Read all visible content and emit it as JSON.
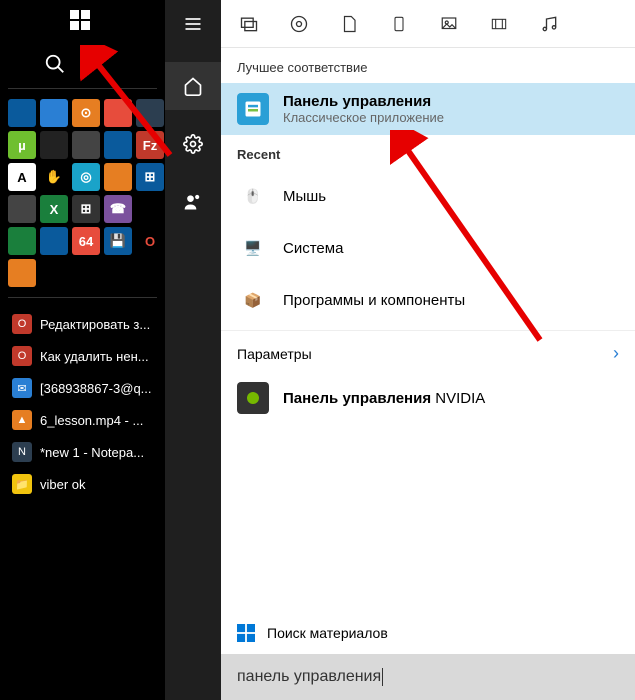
{
  "taskbar_items": [
    {
      "label": "Редактировать з...",
      "icon_bg": "#c0392b",
      "icon_txt": "O"
    },
    {
      "label": "Как удалить нен...",
      "icon_bg": "#c0392b",
      "icon_txt": "O"
    },
    {
      "label": "[368938867-3@q...",
      "icon_bg": "#2a7fd4",
      "icon_txt": "✉"
    },
    {
      "label": "6_lesson.mp4 - ...",
      "icon_bg": "#e67e22",
      "icon_txt": "▲"
    },
    {
      "label": "*new 1 - Notepa...",
      "icon_bg": "#2c3e50",
      "icon_txt": "N"
    },
    {
      "label": "viber ok",
      "icon_bg": "#f1c40f",
      "icon_txt": "📁"
    }
  ],
  "search": {
    "best_match_label": "Лучшее соответствие",
    "best_match": {
      "title": "Панель управления",
      "subtitle": "Классическое приложение"
    },
    "recent_label": "Recent",
    "recent": [
      {
        "label": "Мышь"
      },
      {
        "label": "Система"
      },
      {
        "label": "Программы и компоненты"
      }
    ],
    "params_label": "Параметры",
    "params_items": [
      {
        "title_bold": "Панель управления",
        "title_rest": " NVIDIA"
      }
    ],
    "search_materials": "Поиск материалов",
    "input_value": "панель управления"
  }
}
